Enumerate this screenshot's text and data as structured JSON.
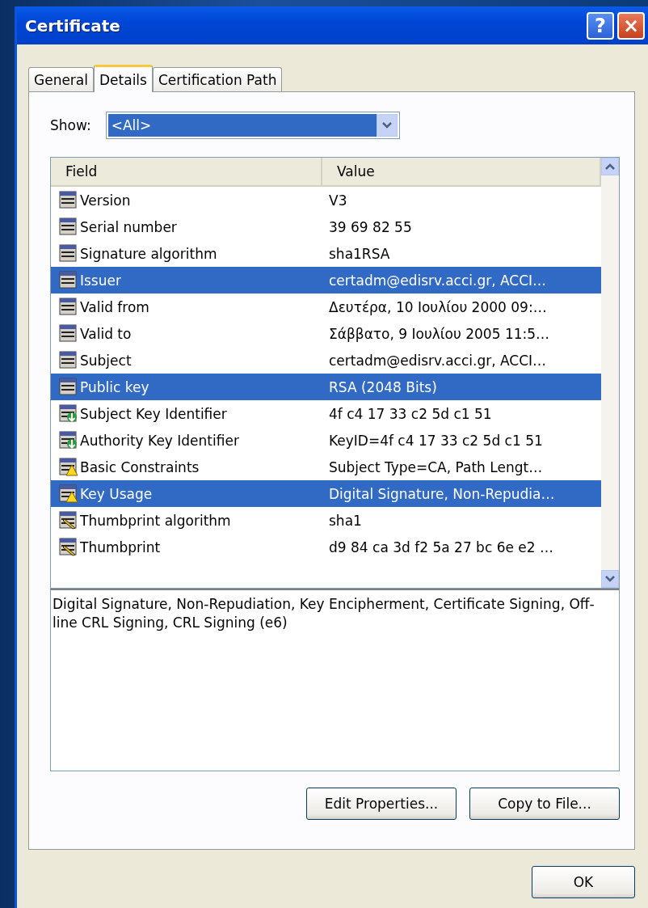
{
  "window": {
    "title": "Certificate",
    "help_button": "?",
    "close_button": "×"
  },
  "tabs": [
    {
      "label": "General",
      "selected": false
    },
    {
      "label": "Details",
      "selected": true
    },
    {
      "label": "Certification Path",
      "selected": false
    }
  ],
  "show": {
    "label": "Show:",
    "value": "<All>"
  },
  "table": {
    "columns": [
      "Field",
      "Value"
    ],
    "rows": [
      {
        "kind": "field",
        "field": "Version",
        "value": "V3",
        "selected": false
      },
      {
        "kind": "field",
        "field": "Serial number",
        "value": "39 69 82 55",
        "selected": false
      },
      {
        "kind": "field",
        "field": "Signature algorithm",
        "value": "sha1RSA",
        "selected": false
      },
      {
        "kind": "field",
        "field": "Issuer",
        "value": "certadm@edisrv.acci.gr, ACCI…",
        "selected": true
      },
      {
        "kind": "field",
        "field": "Valid from",
        "value": "Δευτέρα, 10 Ιουλίου 2000 09:…",
        "selected": false
      },
      {
        "kind": "field",
        "field": "Valid to",
        "value": "Σάββατο, 9 Ιουλίου 2005 11:5…",
        "selected": false
      },
      {
        "kind": "field",
        "field": "Subject",
        "value": "certadm@edisrv.acci.gr, ACCI…",
        "selected": false
      },
      {
        "kind": "field",
        "field": "Public key",
        "value": "RSA (2048 Bits)",
        "selected": true
      },
      {
        "kind": "extension",
        "field": "Subject Key Identifier",
        "value": "4f c4 17 33 c2 5d c1 51",
        "selected": false
      },
      {
        "kind": "extension",
        "field": "Authority Key Identifier",
        "value": "KeyID=4f c4 17 33 c2 5d c1 51",
        "selected": false
      },
      {
        "kind": "critical",
        "field": "Basic Constraints",
        "value": "Subject Type=CA, Path Lengt…",
        "selected": false
      },
      {
        "kind": "critical",
        "field": "Key Usage",
        "value": "Digital Signature, Non-Repudia…",
        "selected": true
      },
      {
        "kind": "property",
        "field": "Thumbprint algorithm",
        "value": "sha1",
        "selected": false
      },
      {
        "kind": "property",
        "field": "Thumbprint",
        "value": "d9 84 ca 3d f2 5a 27 bc 6e e2 …",
        "selected": false
      }
    ]
  },
  "detail_text": "Digital Signature, Non-Repudiation, Key Encipherment, Certificate Signing, Off-line CRL Signing, CRL Signing (e6)",
  "buttons": [
    "Edit Properties...",
    "Copy to File..."
  ],
  "ok_button": "OK"
}
